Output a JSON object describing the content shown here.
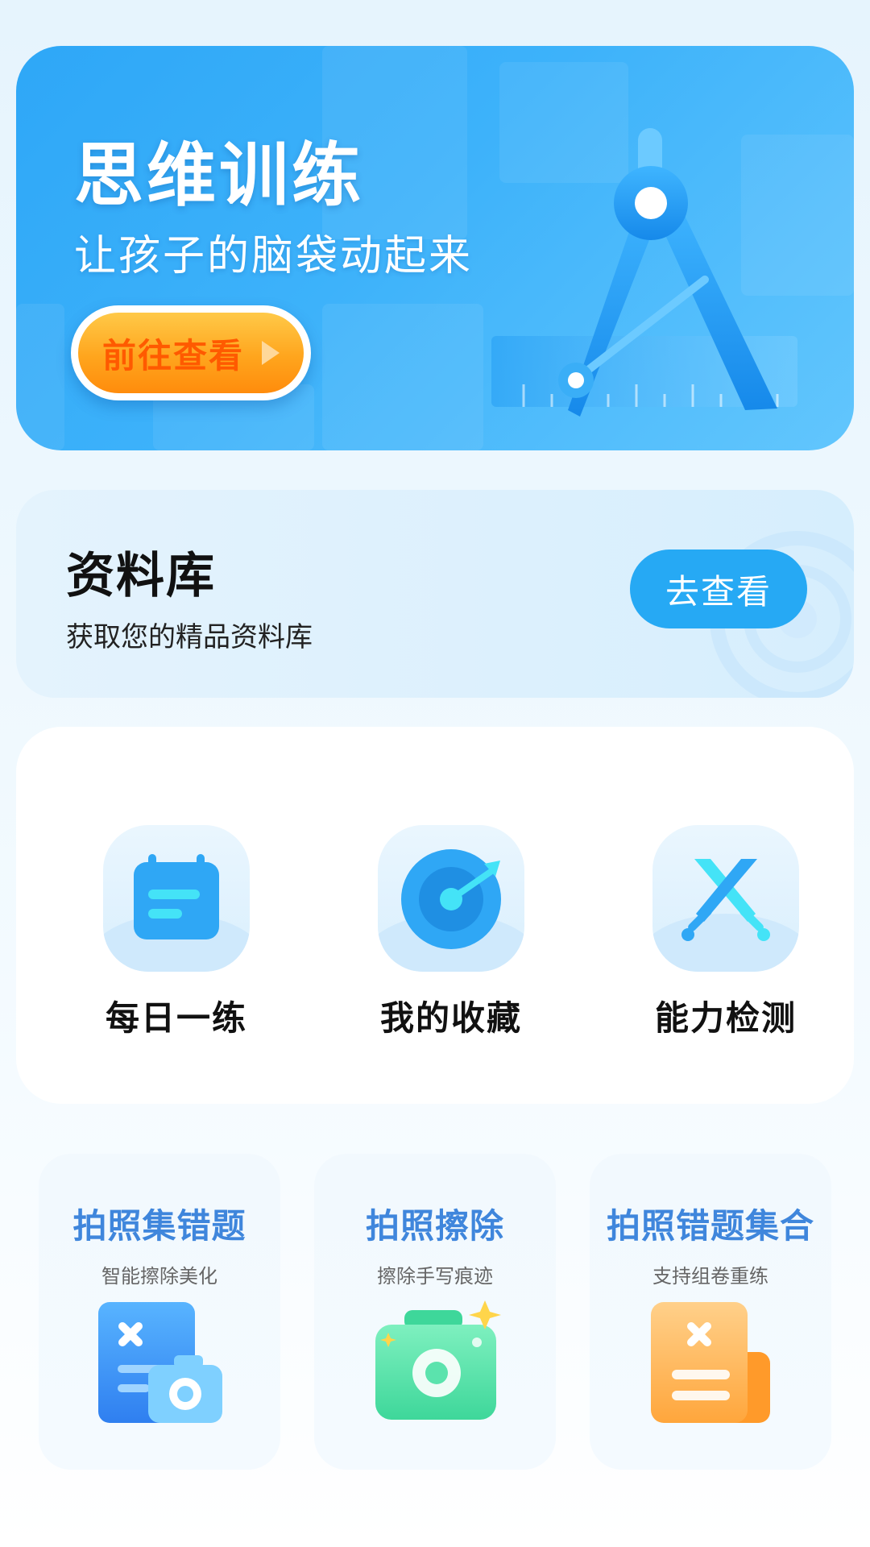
{
  "banner": {
    "title": "思维训练",
    "subtitle": "让孩子的脑袋动起来",
    "button_label": "前往查看",
    "colors": {
      "bg": "#3db2fa",
      "button": "#ffa51d",
      "button_text": "#ff5a00"
    }
  },
  "library": {
    "title": "资料库",
    "description": "获取您的精品资料库",
    "button_label": "去查看"
  },
  "tools": [
    {
      "label": "每日一练",
      "icon": "calendar-icon"
    },
    {
      "label": "我的收藏",
      "icon": "target-icon"
    },
    {
      "label": "能力检测",
      "icon": "crossed-swords-icon"
    }
  ],
  "features": [
    {
      "title": "拍照集错题",
      "subtitle": "智能擦除美化",
      "icon": "wrong-question-camera-icon"
    },
    {
      "title": "拍照擦除",
      "subtitle": "擦除手写痕迹",
      "icon": "camera-sparkle-icon"
    },
    {
      "title": "拍照错题集合",
      "subtitle": "支持组卷重练",
      "icon": "wrong-question-doc-icon"
    }
  ]
}
